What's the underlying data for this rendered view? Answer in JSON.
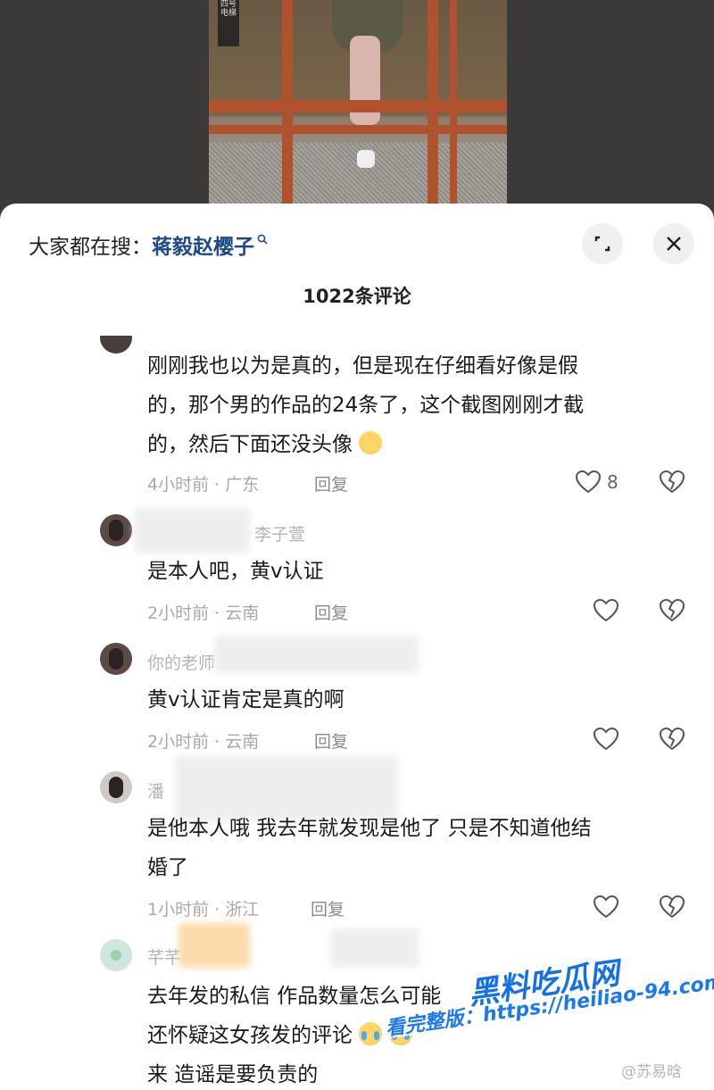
{
  "video": {
    "sign_text": "四号电梯"
  },
  "search": {
    "prefix": "大家都在搜：",
    "term": "蒋毅赵樱子"
  },
  "comments_title": "1022条评论",
  "reply_label": "回复",
  "comments": [
    {
      "username": "",
      "text": [
        "刚刚我也以为是真的，但是现在仔细看好像是假",
        "的，那个男的作品的24条了，这个截图刚刚才截",
        "的，然后下面还没头像"
      ],
      "meta": "4小时前 · 广东",
      "likes": "8"
    },
    {
      "username": "李子萱",
      "text": [
        "是本人吧，黄v认证"
      ],
      "meta": "2小时前 · 云南",
      "likes": ""
    },
    {
      "username": "你的老师",
      "text": [
        "黄v认证肯定是真的啊"
      ],
      "meta": "2小时前 · 云南",
      "likes": ""
    },
    {
      "username": "潘",
      "text": [
        "是他本人哦 我去年就发现是他了 只是不知道他结",
        "婚了"
      ],
      "meta": "1小时前 · 浙江",
      "likes": ""
    },
    {
      "username": "芊芊",
      "text": [
        "去年发的私信 作品数量怎么可能",
        "还怀疑这女孩发的评论",
        "来 造谣是要负责的"
      ],
      "meta": "",
      "likes": ""
    }
  ],
  "watermark": {
    "site": "黑料吃瓜网",
    "url": "看完整版：https://heiliao-94.com",
    "weibo": "@苏易晗"
  },
  "colors": {
    "search_term": "#1f4a86",
    "meta": "#a8a8a8",
    "text": "#1a1a1a"
  }
}
